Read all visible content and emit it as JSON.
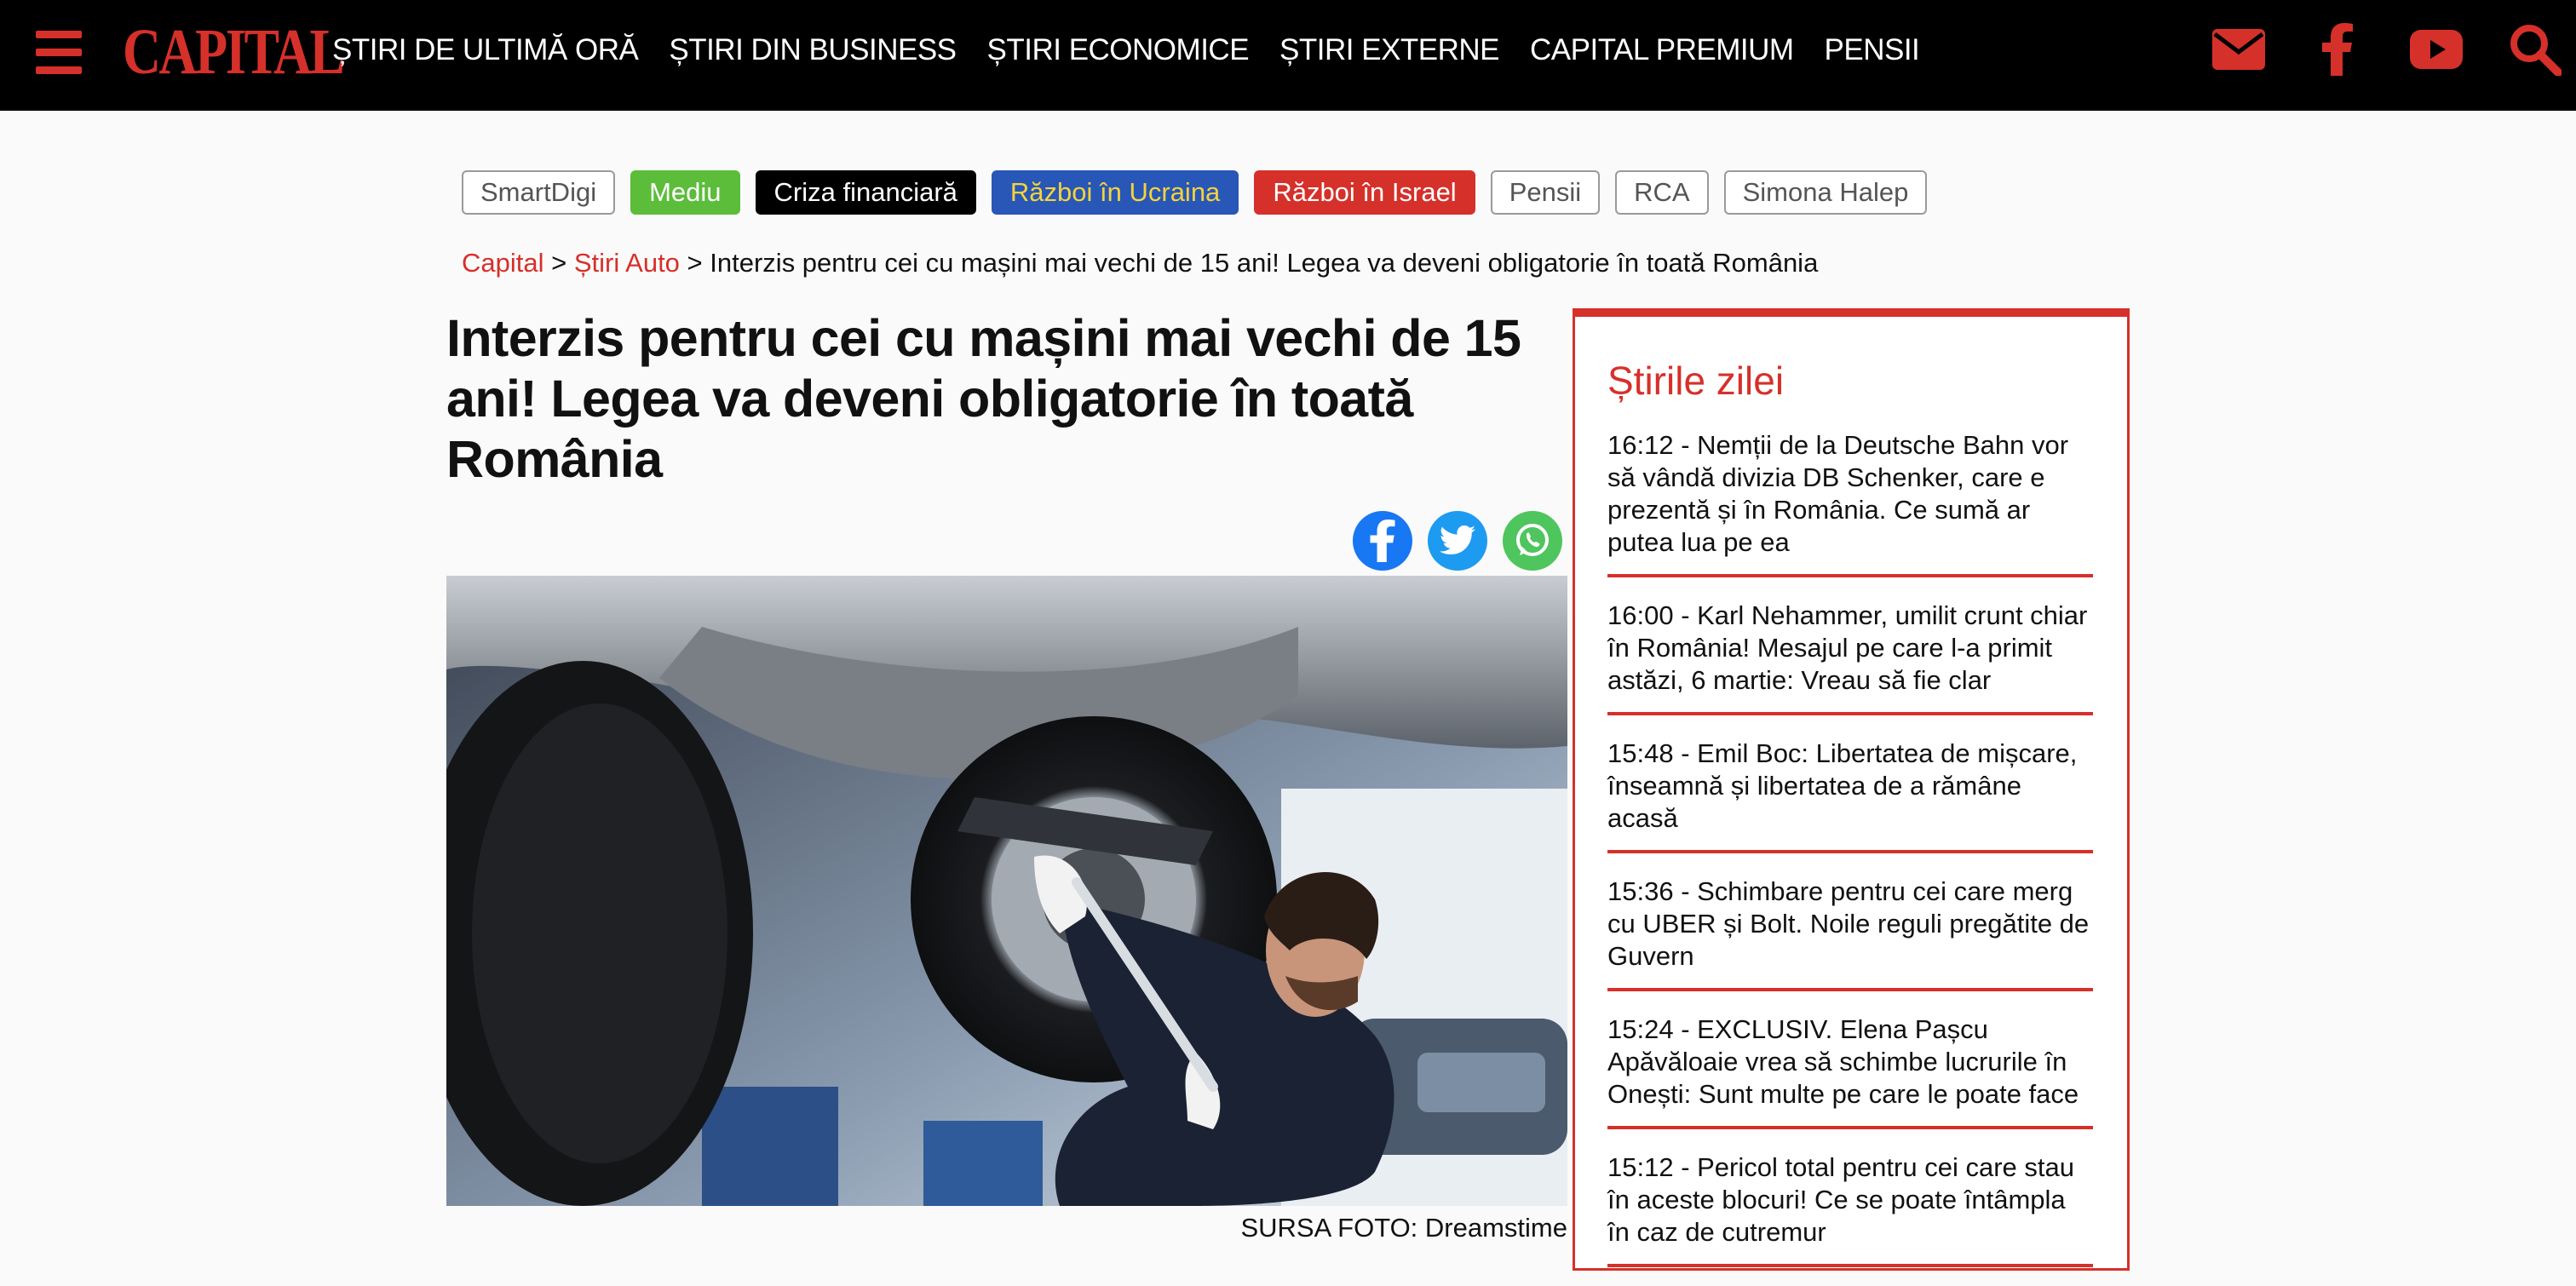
{
  "brand": {
    "logo_text": "CAPITAL",
    "accent": "#d6302a"
  },
  "nav": {
    "items": [
      {
        "label": "ȘTIRI DE ULTIMĂ ORĂ"
      },
      {
        "label": "ȘTIRI DIN BUSINESS"
      },
      {
        "label": "ȘTIRI ECONOMICE"
      },
      {
        "label": "ȘTIRI EXTERNE"
      },
      {
        "label": "CAPITAL PREMIUM"
      },
      {
        "label": "PENSII"
      }
    ],
    "icons": [
      "envelope-icon",
      "facebook-icon",
      "youtube-icon",
      "search-icon"
    ]
  },
  "tags": [
    {
      "label": "SmartDigi",
      "style": "outline"
    },
    {
      "label": "Mediu",
      "style": "green"
    },
    {
      "label": "Criza financiară",
      "style": "black"
    },
    {
      "label": "Război în Ucraina",
      "style": "blue"
    },
    {
      "label": "Război în Israel",
      "style": "red"
    },
    {
      "label": "Pensii",
      "style": "outline"
    },
    {
      "label": "RCA",
      "style": "outline"
    },
    {
      "label": "Simona Halep",
      "style": "outline"
    }
  ],
  "breadcrumb": {
    "home": "Capital",
    "section": "Știri Auto",
    "sep": ">",
    "current": "Interzis pentru cei cu mașini mai vechi de 15 ani! Legea va deveni obligatorie în toată România"
  },
  "article": {
    "title": "Interzis pentru cei cu mașini mai vechi de 15 ani! Legea va deveni obligatorie în toată România",
    "photo_caption": "SURSA FOTO: Dreamstime",
    "share_icons": [
      "facebook-icon",
      "twitter-icon",
      "whatsapp-icon"
    ]
  },
  "sidebar": {
    "title": "Știrile zilei",
    "items": [
      {
        "text": "16:12 - Nemții de la Deutsche Bahn vor să vândă divizia DB Schenker, care e prezentă și în România. Ce sumă ar putea lua pe ea"
      },
      {
        "text": "16:00 - Karl Nehammer, umilit crunt chiar în România! Mesajul pe care l-a primit astăzi, 6 martie: Vreau să fie clar"
      },
      {
        "text": "15:48 - Emil Boc: Libertatea de mișcare, înseamnă și libertatea de a rămâne acasă"
      },
      {
        "text": "15:36 - Schimbare pentru cei care merg cu UBER și Bolt. Noile reguli pregătite de Guvern"
      },
      {
        "text": "15:24 - EXCLUSIV. Elena Pașcu Apăvăloaie vrea să schimbe lucrurile în Onești: Sunt multe pe care le poate face"
      },
      {
        "text": "15:12 - Pericol total pentru cei care stau în aceste blocuri! Ce se poate întâmpla în caz de cutremur"
      }
    ]
  }
}
